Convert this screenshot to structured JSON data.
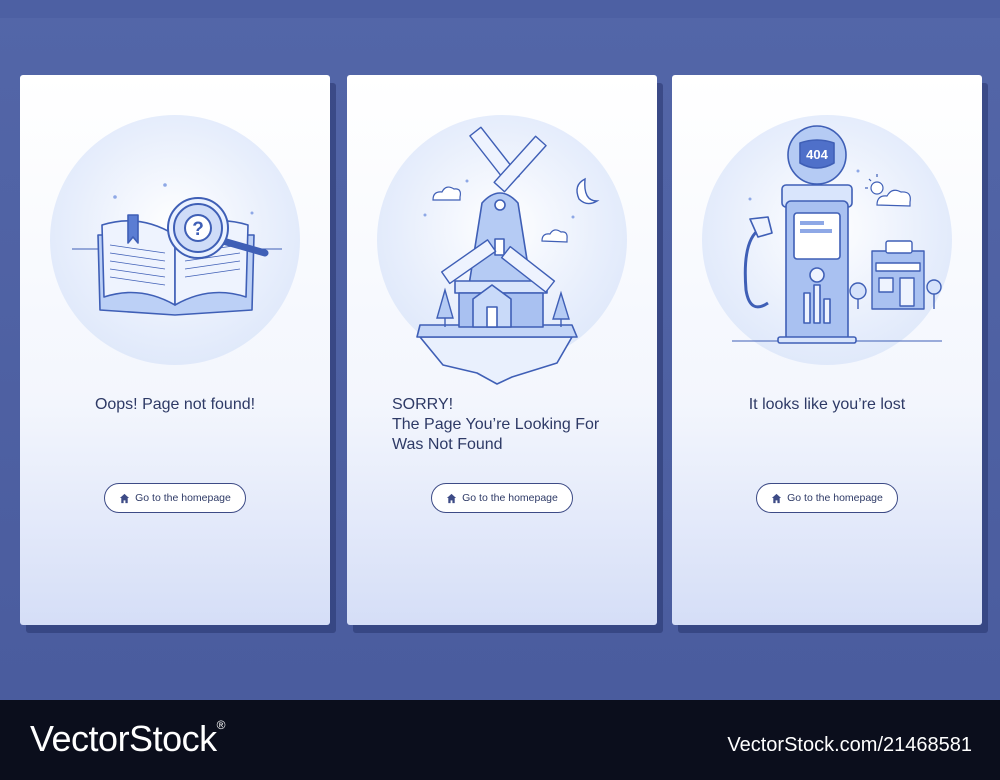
{
  "cards": [
    {
      "message": "Oops! Page not found!",
      "button_label": "Go to the homepage"
    },
    {
      "message_lines": [
        "SORRY!",
        "The Page You’re Looking For",
        "Was Not Found"
      ],
      "button_label": "Go to the homepage"
    },
    {
      "message": "It looks like you’re lost",
      "button_label": "Go to the homepage"
    }
  ],
  "pump_sign": "404",
  "footer": {
    "brand": "VectorStock",
    "brand_mark": "®",
    "stock_id": "VectorStock.com/21468581"
  },
  "colors": {
    "background": "#4a5c9e",
    "card_text": "#2e3a66",
    "illustration_stroke": "#3f5fb6",
    "illustration_fill": "#b9cdf5",
    "footer_bg": "#0b0e1c"
  },
  "icons": [
    "home-icon",
    "book-icon",
    "magnifier-icon",
    "windmill-icon",
    "moon-icon",
    "cloud-icon",
    "gas-pump-icon",
    "shop-icon",
    "sun-icon"
  ]
}
